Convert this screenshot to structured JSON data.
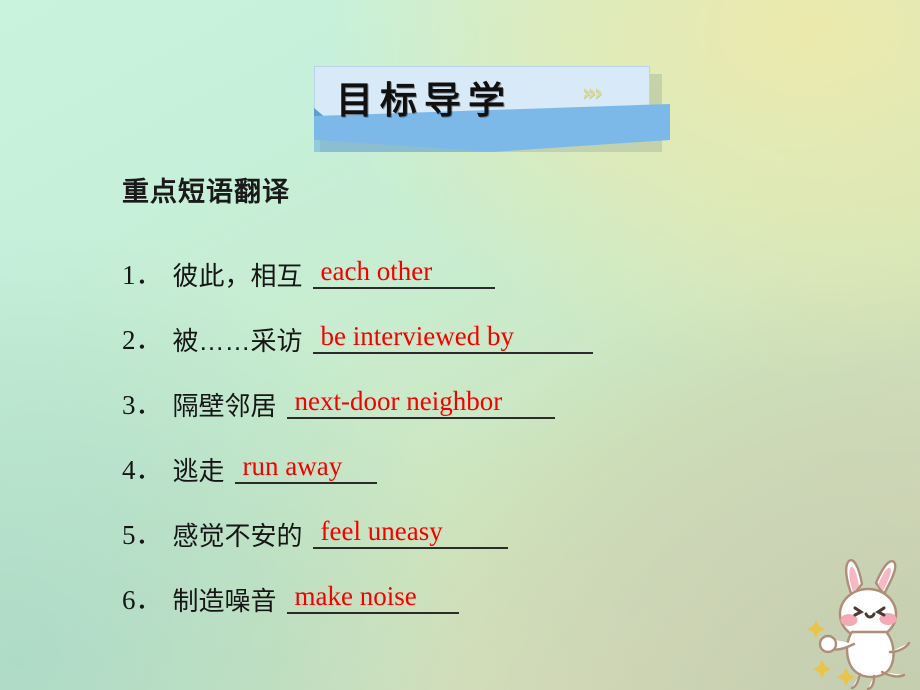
{
  "slide": {
    "background_colors": {
      "top_left": "#c9f3dd",
      "top_right": "#ece8ae",
      "bottom_left": "#a9d9c8",
      "bottom_right": "#c4cdb0"
    }
  },
  "banner": {
    "title": "目标导学",
    "arrows": "»›",
    "panel_color": "#d8e9f8",
    "ribbon_color": "#7cb9e8",
    "arrow_color": "#d8dca0"
  },
  "heading": {
    "text": "重点短语翻译"
  },
  "answer_color": "#f40000",
  "phrases": [
    {
      "num": "1．",
      "chinese": "彼此，相互",
      "answer": "each other"
    },
    {
      "num": "2．",
      "chinese": "被……采访",
      "answer": "be interviewed by"
    },
    {
      "num": "3．",
      "chinese": "隔壁邻居",
      "answer": "next-door neighbor"
    },
    {
      "num": "4．",
      "chinese": "逃走",
      "answer": "run away"
    },
    {
      "num": "5．",
      "chinese": "感觉不安的",
      "answer": "feel uneasy"
    },
    {
      "num": "6．",
      "chinese": "制造噪音",
      "answer": "make noise"
    }
  ],
  "mascot": {
    "name": "rabbit-mascot",
    "body_color": "#ffffff",
    "outline_color": "#b08d78",
    "cheek_color": "#f4aab4",
    "star_color": "#e8c44a"
  }
}
